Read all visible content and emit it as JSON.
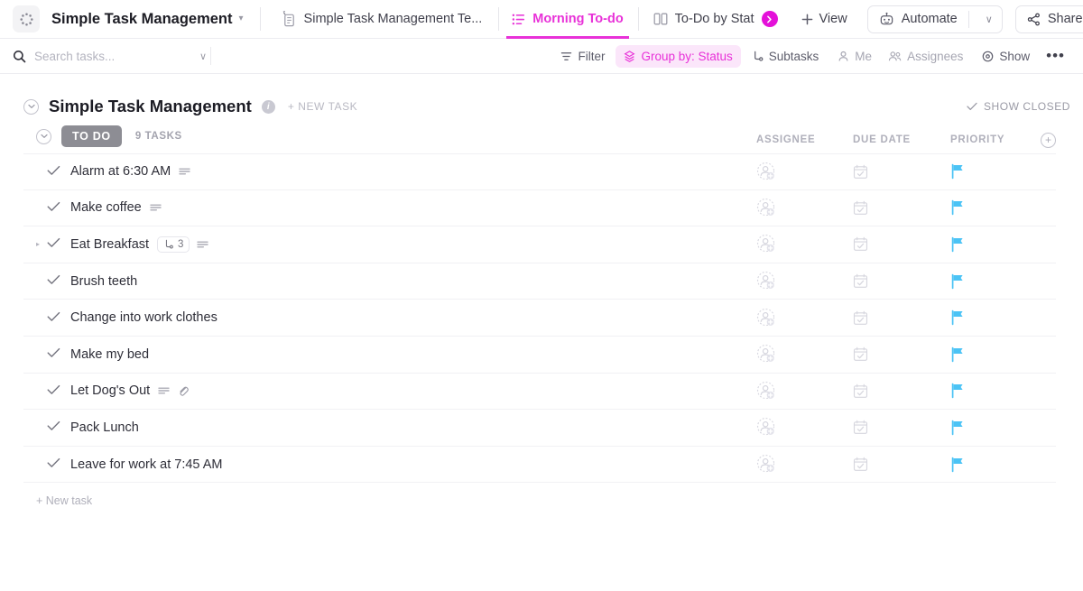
{
  "topbar": {
    "logo_icon": "dot-circle-logo-icon",
    "space_title": "Simple Task Management",
    "space_caret": "▾",
    "tabs": [
      {
        "icon": "pinned-doc-icon",
        "label": "Simple Task Management Te...",
        "active": false
      },
      {
        "icon": "list-view-icon",
        "label": "Morning To-do",
        "active": true
      },
      {
        "icon": "board-view-icon",
        "label": "To-Do by Stat",
        "active": false,
        "badge": "❯"
      }
    ],
    "add_view_label": "View",
    "add_view_icon": "plus-icon",
    "automate_label": "Automate",
    "automate_icon": "robot-icon",
    "automate_caret": "∨",
    "share_label": "Share",
    "share_icon": "share-nodes-icon"
  },
  "toolbar": {
    "search_placeholder": "Search tasks...",
    "search_value": "",
    "search_icon": "search-icon",
    "search_caret": "∨",
    "items": [
      {
        "label": "Filter",
        "icon": "filter-icon",
        "state": "normal"
      },
      {
        "label": "Group by: Status",
        "icon": "group-by-icon",
        "state": "highlight"
      },
      {
        "label": "Subtasks",
        "icon": "subtasks-icon",
        "state": "normal"
      },
      {
        "label": "Me",
        "icon": "person-icon",
        "state": "muted"
      },
      {
        "label": "Assignees",
        "icon": "people-icon",
        "state": "muted"
      },
      {
        "label": "Show",
        "icon": "eye-circle-icon",
        "state": "normal"
      }
    ],
    "more_icon": "ellipsis-icon",
    "more_label": "•••"
  },
  "list_header": {
    "collapse_icon": "chevron-down-circle-icon",
    "title": "Simple Task Management",
    "info_icon": "info-icon",
    "info_glyph": "i",
    "new_task_label": "+ NEW TASK",
    "show_closed_label": "SHOW CLOSED",
    "show_closed_icon": "check-icon"
  },
  "group": {
    "collapse_icon": "chevron-down-circle-icon",
    "status_label": "TO DO",
    "task_count_label": "9 TASKS",
    "status_color": "#8d8d94",
    "columns": [
      {
        "label": "ASSIGNEE",
        "key": "assignee"
      },
      {
        "label": "DUE DATE",
        "key": "due_date"
      },
      {
        "label": "PRIORITY",
        "key": "priority"
      }
    ],
    "add_column_icon": "plus-circle-icon"
  },
  "tasks": [
    {
      "name": "Alarm at 6:30 AM",
      "expandable": false,
      "has_description": true,
      "has_attachment": false,
      "subtask_count": null,
      "assignee_icon": "add-assignee-icon",
      "due_date_icon": "calendar-icon",
      "priority_icon": "flag-icon"
    },
    {
      "name": "Make coffee",
      "expandable": false,
      "has_description": true,
      "has_attachment": false,
      "subtask_count": null,
      "assignee_icon": "add-assignee-icon",
      "due_date_icon": "calendar-icon",
      "priority_icon": "flag-icon"
    },
    {
      "name": "Eat Breakfast",
      "expandable": true,
      "has_description": true,
      "has_attachment": false,
      "subtask_count": "3",
      "assignee_icon": "add-assignee-icon",
      "due_date_icon": "calendar-icon",
      "priority_icon": "flag-icon"
    },
    {
      "name": "Brush teeth",
      "expandable": false,
      "has_description": false,
      "has_attachment": false,
      "subtask_count": null,
      "assignee_icon": "add-assignee-icon",
      "due_date_icon": "calendar-icon",
      "priority_icon": "flag-icon"
    },
    {
      "name": "Change into work clothes",
      "expandable": false,
      "has_description": false,
      "has_attachment": false,
      "subtask_count": null,
      "assignee_icon": "add-assignee-icon",
      "due_date_icon": "calendar-icon",
      "priority_icon": "flag-icon"
    },
    {
      "name": "Make my bed",
      "expandable": false,
      "has_description": false,
      "has_attachment": false,
      "subtask_count": null,
      "assignee_icon": "add-assignee-icon",
      "due_date_icon": "calendar-icon",
      "priority_icon": "flag-icon"
    },
    {
      "name": "Let Dog's Out",
      "expandable": false,
      "has_description": true,
      "has_attachment": true,
      "subtask_count": null,
      "assignee_icon": "add-assignee-icon",
      "due_date_icon": "calendar-icon",
      "priority_icon": "flag-icon"
    },
    {
      "name": "Pack Lunch",
      "expandable": false,
      "has_description": false,
      "has_attachment": false,
      "subtask_count": null,
      "assignee_icon": "add-assignee-icon",
      "due_date_icon": "calendar-icon",
      "priority_icon": "flag-icon"
    },
    {
      "name": "Leave for work at 7:45 AM",
      "expandable": false,
      "has_description": false,
      "has_attachment": false,
      "subtask_count": null,
      "assignee_icon": "add-assignee-icon",
      "due_date_icon": "calendar-icon",
      "priority_icon": "flag-icon"
    }
  ],
  "footer": {
    "new_task_label": "+ New task"
  },
  "colors": {
    "accent_pink": "#e831d8",
    "priority_flag": "#4bc3f5",
    "status_grey": "#8d8d94",
    "text_primary": "#2e2e38",
    "text_muted": "#a6a6b2"
  }
}
